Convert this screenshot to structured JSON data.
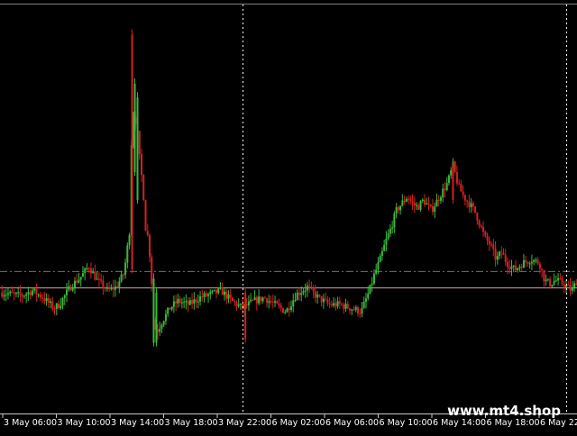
{
  "watermark": "www.mt4.shop",
  "colors": {
    "background": "#000000",
    "bull": "#3cb83c",
    "bear": "#d62020",
    "axis": "#c8c8c8",
    "label": "#ffffff",
    "level_green": "#2f9a4a",
    "level_pink": "#d8a0b0",
    "crosshair": "#ffffff"
  },
  "chart_data": {
    "type": "candlestick",
    "x_tick_labels": [
      "3 May 06:00",
      "3 May 10:00",
      "3 May 14:00",
      "3 May 18:00",
      "3 May 22:00",
      "6 May 02:00",
      "6 May 06:00",
      "6 May 10:00",
      "6 May 14:00",
      "6 May 18:00",
      "6 May 22:"
    ],
    "vertical_lines": [
      {
        "name": "crosshair-vertical",
        "x": 90
      },
      {
        "name": "chart-right-separator",
        "x": 210
      }
    ],
    "horizontal_levels": [
      {
        "name": "green-dash-dot-level",
        "y": 100.5
      },
      {
        "name": "pink-level",
        "y": 95.8
      }
    ],
    "y_range": [
      60,
      172
    ],
    "x_range": [
      0,
      214
    ],
    "close_path": [
      [
        0,
        94.5
      ],
      [
        4,
        94
      ],
      [
        8,
        93.5
      ],
      [
        12,
        95
      ],
      [
        16,
        93
      ],
      [
        20,
        90
      ],
      [
        22,
        91
      ],
      [
        26,
        96
      ],
      [
        30,
        99
      ],
      [
        33,
        102
      ],
      [
        36,
        98
      ],
      [
        40,
        95
      ],
      [
        43,
        96
      ],
      [
        46,
        100
      ],
      [
        48,
        112
      ],
      [
        49,
        146
      ],
      [
        50,
        145
      ],
      [
        51,
        140
      ],
      [
        52,
        131
      ],
      [
        53,
        125
      ],
      [
        54,
        113
      ],
      [
        55,
        110
      ],
      [
        56,
        101
      ],
      [
        57,
        87
      ],
      [
        58,
        83
      ],
      [
        60,
        86
      ],
      [
        63,
        90
      ],
      [
        66,
        92
      ],
      [
        70,
        91
      ],
      [
        74,
        93
      ],
      [
        78,
        94
      ],
      [
        82,
        95
      ],
      [
        86,
        92
      ],
      [
        90,
        90
      ],
      [
        94,
        92
      ],
      [
        98,
        93
      ],
      [
        102,
        91
      ],
      [
        106,
        89
      ],
      [
        110,
        94
      ],
      [
        114,
        96
      ],
      [
        118,
        93
      ],
      [
        122,
        91
      ],
      [
        126,
        91
      ],
      [
        130,
        90
      ],
      [
        134,
        89
      ],
      [
        137,
        95
      ],
      [
        139,
        100
      ],
      [
        141,
        104
      ],
      [
        143,
        109
      ],
      [
        145,
        113
      ],
      [
        147,
        118
      ],
      [
        149,
        120
      ],
      [
        151,
        122
      ],
      [
        153,
        120
      ],
      [
        155,
        119
      ],
      [
        157,
        121
      ],
      [
        160,
        118
      ],
      [
        163,
        122
      ],
      [
        166,
        126
      ],
      [
        168,
        131
      ],
      [
        170,
        125
      ],
      [
        172,
        122
      ],
      [
        174,
        120
      ],
      [
        176,
        118
      ],
      [
        178,
        114
      ],
      [
        180,
        110
      ],
      [
        182,
        108
      ],
      [
        184,
        104
      ],
      [
        186,
        106
      ],
      [
        188,
        103
      ],
      [
        191,
        101
      ],
      [
        194,
        103
      ],
      [
        197,
        104
      ],
      [
        200,
        103
      ],
      [
        202,
        98
      ],
      [
        204,
        97
      ],
      [
        206,
        98
      ],
      [
        209,
        97
      ],
      [
        212,
        95
      ],
      [
        214,
        98
      ]
    ],
    "spikes": [
      {
        "x": 49,
        "high": 170,
        "low": 100,
        "dir": "bear"
      },
      {
        "x": 50,
        "high": 156,
        "low": 128,
        "dir": "bull"
      },
      {
        "x": 51,
        "high": 152,
        "low": 120,
        "dir": "bull"
      },
      {
        "x": 57,
        "high": 100,
        "low": 79,
        "dir": "bull"
      },
      {
        "x": 58,
        "high": 96,
        "low": 79,
        "dir": "bull"
      },
      {
        "x": 91,
        "high": 96,
        "low": 80,
        "dir": "bear"
      },
      {
        "x": 168,
        "high": 132,
        "low": 120,
        "dir": "bear"
      }
    ]
  }
}
